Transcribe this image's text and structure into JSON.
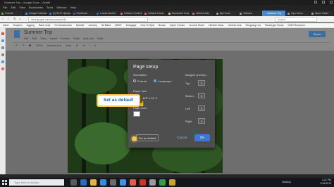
{
  "window": {
    "title": "Summer Trip - Google Docs - Vivaldi"
  },
  "menubar": {
    "items": [
      "File",
      "Edit",
      "View",
      "Bookmarks",
      "Tools",
      "Window",
      "Help"
    ]
  },
  "tabs": [
    {
      "label": "Fortnite",
      "color": "#6aa84f"
    },
    {
      "label": "Google Calendar",
      "color": "#4285f4"
    },
    {
      "label": "(2) Wi-Fi Upload",
      "color": "#3c78d8"
    },
    {
      "label": "Facebook",
      "color": "#3b5998"
    },
    {
      "label": "Lowes Issued",
      "color": "#2a6ebb"
    },
    {
      "label": "Lifewire Content",
      "color": "#e06666"
    },
    {
      "label": "Lifewire Home",
      "color": "#e06666"
    },
    {
      "label": "Structured Cont",
      "color": "#f6b26b"
    },
    {
      "label": "Lifewire Arts",
      "color": "#e06666"
    },
    {
      "label": "My Home",
      "color": "#999999"
    },
    {
      "label": "Window",
      "color": "#999999"
    },
    {
      "label": "Summer Trip",
      "color": "#4285f4",
      "active": true
    },
    {
      "label": "Sync Docs",
      "color": "#999999"
    },
    {
      "label": "Spam Order",
      "color": "#999999"
    }
  ],
  "address": {
    "url": "docs.google.com/document/d/1f...",
    "search_placeholder": "Search"
  },
  "bookmarks": [
    "Inbox",
    "Dropbox",
    "Aggreg",
    "Bank Jobs",
    "Fox Bookmarks",
    "Spindle",
    "Journey",
    "All Bikes",
    "BNSF",
    "Mortgage",
    "How To Sjob",
    "Books",
    "Gyber Choice",
    "Income Sheet",
    "Lifewire Ideas",
    "Lifewire Arts",
    "Shopping List",
    "Passenger Brook",
    "OMG Research"
  ],
  "doc": {
    "title": "Summer Trip",
    "menu": [
      "File",
      "Edit",
      "View",
      "Insert",
      "Format",
      "Tools",
      "Add-ons",
      "Help"
    ],
    "toolbar": [
      "↶",
      "↷",
      "🖶",
      "100%",
      "Normal text",
      "Arial",
      "11",
      "B",
      "I",
      "U"
    ],
    "share_label": "Share"
  },
  "dialog": {
    "title": "Page setup",
    "orientation_label": "Orientation",
    "portrait_label": "Portrait",
    "landscape_label": "Landscape",
    "paper_size_label": "Paper size",
    "paper_size_value": "8.5\" x 11\" ▾",
    "page_color_label": "Page color",
    "margins_label": "Margins (inches)",
    "top_label": "Top",
    "top_value": "1",
    "bottom_label": "Bottom",
    "bottom_value": "1",
    "left_label": "Left",
    "left_value": "1",
    "right_label": "Right",
    "right_value": "1",
    "set_default_label": "Set as default",
    "cancel_label": "Cancel",
    "ok_label": "OK"
  },
  "callout": {
    "text": "Set as default"
  },
  "taskbar": {
    "search_placeholder": "Type here to search",
    "tray_label": "Desktop",
    "time": "1:21 PM",
    "date": "3/16/2019"
  }
}
